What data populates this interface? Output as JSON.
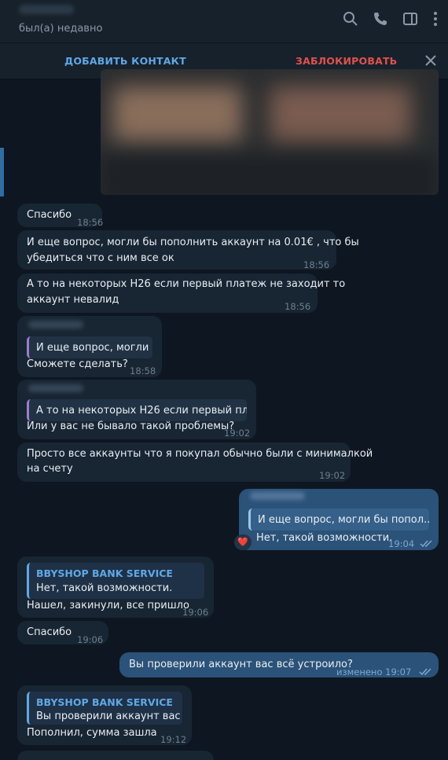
{
  "header": {
    "status": "был(а) недавно",
    "icons": [
      "search-icon",
      "phone-icon",
      "sidebar-icon",
      "more-vert-icon"
    ]
  },
  "actionbar": {
    "add_contact": "ДОБАВИТЬ КОНТАКТ",
    "block": "ЗАБЛОКИРОВАТЬ"
  },
  "colors": {
    "accent": "#5fa8e6",
    "danger": "#e0514d",
    "incoming": "#182533",
    "outgoing": "#2b5278",
    "bg": "#0e1621"
  },
  "messages": {
    "m1": {
      "text": "Спасибо",
      "time": "18:56"
    },
    "m2": {
      "line1": "И еще вопрос, могли бы пополнить аккаунт на 0.01€ , что бы",
      "line2": "убедиться что с ним все ок",
      "time": "18:56"
    },
    "m3": {
      "line1": "А то на некоторых Н26 если первый платеж не заходит то",
      "line2": "аккаунт невалид",
      "time": "18:56"
    },
    "m4": {
      "quote": "И еще вопрос, могли ...",
      "text": "Сможете сделать?",
      "time": "18:58"
    },
    "m5": {
      "quote": "А то на некоторых Н26 если первый плат...",
      "text": "Или у вас не бывало такой проблемы?",
      "time": "19:02"
    },
    "m6": {
      "line1": "Просто все аккаунты что я покупал обычно были с минималкой",
      "line2": "на счету",
      "time": "19:02"
    },
    "m7": {
      "quote": "И еще вопрос, могли бы попол...",
      "text": "Нет, такой возможности.",
      "time": "19:04",
      "reaction": "❤️"
    },
    "m8": {
      "quote_name": "BBYSHOP BANK SERVICE",
      "quote": "Нет, такой возможности.",
      "text": "Нашел, закинули, все пришло",
      "time": "19:06"
    },
    "m9": {
      "text": "Спасибо",
      "time": "19:06"
    },
    "m10": {
      "text": "Вы проверили аккаунт вас всё устроило?",
      "time": "изменено 19:07"
    },
    "m11": {
      "quote_name": "BBYSHOP BANK SERVICE",
      "quote": "Вы проверили аккаунт вас ...",
      "text": "Пополнил, сумма зашла",
      "time": "19:12"
    }
  }
}
